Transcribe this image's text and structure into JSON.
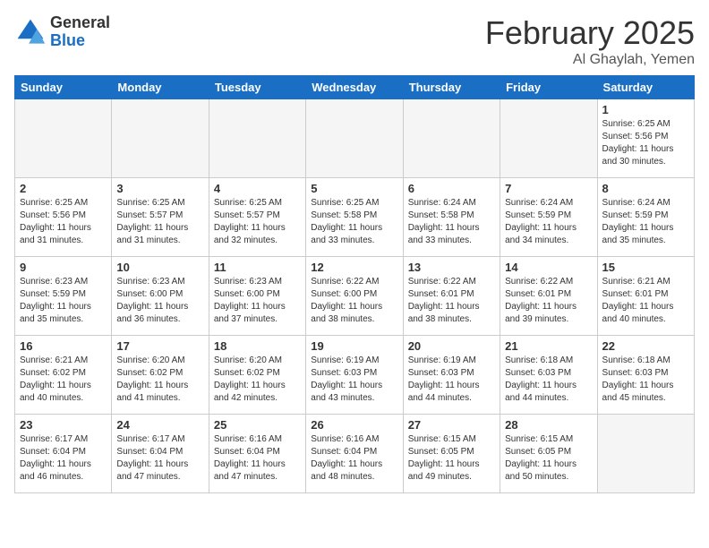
{
  "logo": {
    "general": "General",
    "blue": "Blue"
  },
  "title": {
    "month_year": "February 2025",
    "location": "Al Ghaylah, Yemen"
  },
  "weekdays": [
    "Sunday",
    "Monday",
    "Tuesday",
    "Wednesday",
    "Thursday",
    "Friday",
    "Saturday"
  ],
  "weeks": [
    [
      {
        "day": "",
        "info": ""
      },
      {
        "day": "",
        "info": ""
      },
      {
        "day": "",
        "info": ""
      },
      {
        "day": "",
        "info": ""
      },
      {
        "day": "",
        "info": ""
      },
      {
        "day": "",
        "info": ""
      },
      {
        "day": "1",
        "info": "Sunrise: 6:25 AM\nSunset: 5:56 PM\nDaylight: 11 hours\nand 30 minutes."
      }
    ],
    [
      {
        "day": "2",
        "info": "Sunrise: 6:25 AM\nSunset: 5:56 PM\nDaylight: 11 hours\nand 31 minutes."
      },
      {
        "day": "3",
        "info": "Sunrise: 6:25 AM\nSunset: 5:57 PM\nDaylight: 11 hours\nand 31 minutes."
      },
      {
        "day": "4",
        "info": "Sunrise: 6:25 AM\nSunset: 5:57 PM\nDaylight: 11 hours\nand 32 minutes."
      },
      {
        "day": "5",
        "info": "Sunrise: 6:25 AM\nSunset: 5:58 PM\nDaylight: 11 hours\nand 33 minutes."
      },
      {
        "day": "6",
        "info": "Sunrise: 6:24 AM\nSunset: 5:58 PM\nDaylight: 11 hours\nand 33 minutes."
      },
      {
        "day": "7",
        "info": "Sunrise: 6:24 AM\nSunset: 5:59 PM\nDaylight: 11 hours\nand 34 minutes."
      },
      {
        "day": "8",
        "info": "Sunrise: 6:24 AM\nSunset: 5:59 PM\nDaylight: 11 hours\nand 35 minutes."
      }
    ],
    [
      {
        "day": "9",
        "info": "Sunrise: 6:23 AM\nSunset: 5:59 PM\nDaylight: 11 hours\nand 35 minutes."
      },
      {
        "day": "10",
        "info": "Sunrise: 6:23 AM\nSunset: 6:00 PM\nDaylight: 11 hours\nand 36 minutes."
      },
      {
        "day": "11",
        "info": "Sunrise: 6:23 AM\nSunset: 6:00 PM\nDaylight: 11 hours\nand 37 minutes."
      },
      {
        "day": "12",
        "info": "Sunrise: 6:22 AM\nSunset: 6:00 PM\nDaylight: 11 hours\nand 38 minutes."
      },
      {
        "day": "13",
        "info": "Sunrise: 6:22 AM\nSunset: 6:01 PM\nDaylight: 11 hours\nand 38 minutes."
      },
      {
        "day": "14",
        "info": "Sunrise: 6:22 AM\nSunset: 6:01 PM\nDaylight: 11 hours\nand 39 minutes."
      },
      {
        "day": "15",
        "info": "Sunrise: 6:21 AM\nSunset: 6:01 PM\nDaylight: 11 hours\nand 40 minutes."
      }
    ],
    [
      {
        "day": "16",
        "info": "Sunrise: 6:21 AM\nSunset: 6:02 PM\nDaylight: 11 hours\nand 40 minutes."
      },
      {
        "day": "17",
        "info": "Sunrise: 6:20 AM\nSunset: 6:02 PM\nDaylight: 11 hours\nand 41 minutes."
      },
      {
        "day": "18",
        "info": "Sunrise: 6:20 AM\nSunset: 6:02 PM\nDaylight: 11 hours\nand 42 minutes."
      },
      {
        "day": "19",
        "info": "Sunrise: 6:19 AM\nSunset: 6:03 PM\nDaylight: 11 hours\nand 43 minutes."
      },
      {
        "day": "20",
        "info": "Sunrise: 6:19 AM\nSunset: 6:03 PM\nDaylight: 11 hours\nand 44 minutes."
      },
      {
        "day": "21",
        "info": "Sunrise: 6:18 AM\nSunset: 6:03 PM\nDaylight: 11 hours\nand 44 minutes."
      },
      {
        "day": "22",
        "info": "Sunrise: 6:18 AM\nSunset: 6:03 PM\nDaylight: 11 hours\nand 45 minutes."
      }
    ],
    [
      {
        "day": "23",
        "info": "Sunrise: 6:17 AM\nSunset: 6:04 PM\nDaylight: 11 hours\nand 46 minutes."
      },
      {
        "day": "24",
        "info": "Sunrise: 6:17 AM\nSunset: 6:04 PM\nDaylight: 11 hours\nand 47 minutes."
      },
      {
        "day": "25",
        "info": "Sunrise: 6:16 AM\nSunset: 6:04 PM\nDaylight: 11 hours\nand 47 minutes."
      },
      {
        "day": "26",
        "info": "Sunrise: 6:16 AM\nSunset: 6:04 PM\nDaylight: 11 hours\nand 48 minutes."
      },
      {
        "day": "27",
        "info": "Sunrise: 6:15 AM\nSunset: 6:05 PM\nDaylight: 11 hours\nand 49 minutes."
      },
      {
        "day": "28",
        "info": "Sunrise: 6:15 AM\nSunset: 6:05 PM\nDaylight: 11 hours\nand 50 minutes."
      },
      {
        "day": "",
        "info": ""
      }
    ]
  ]
}
